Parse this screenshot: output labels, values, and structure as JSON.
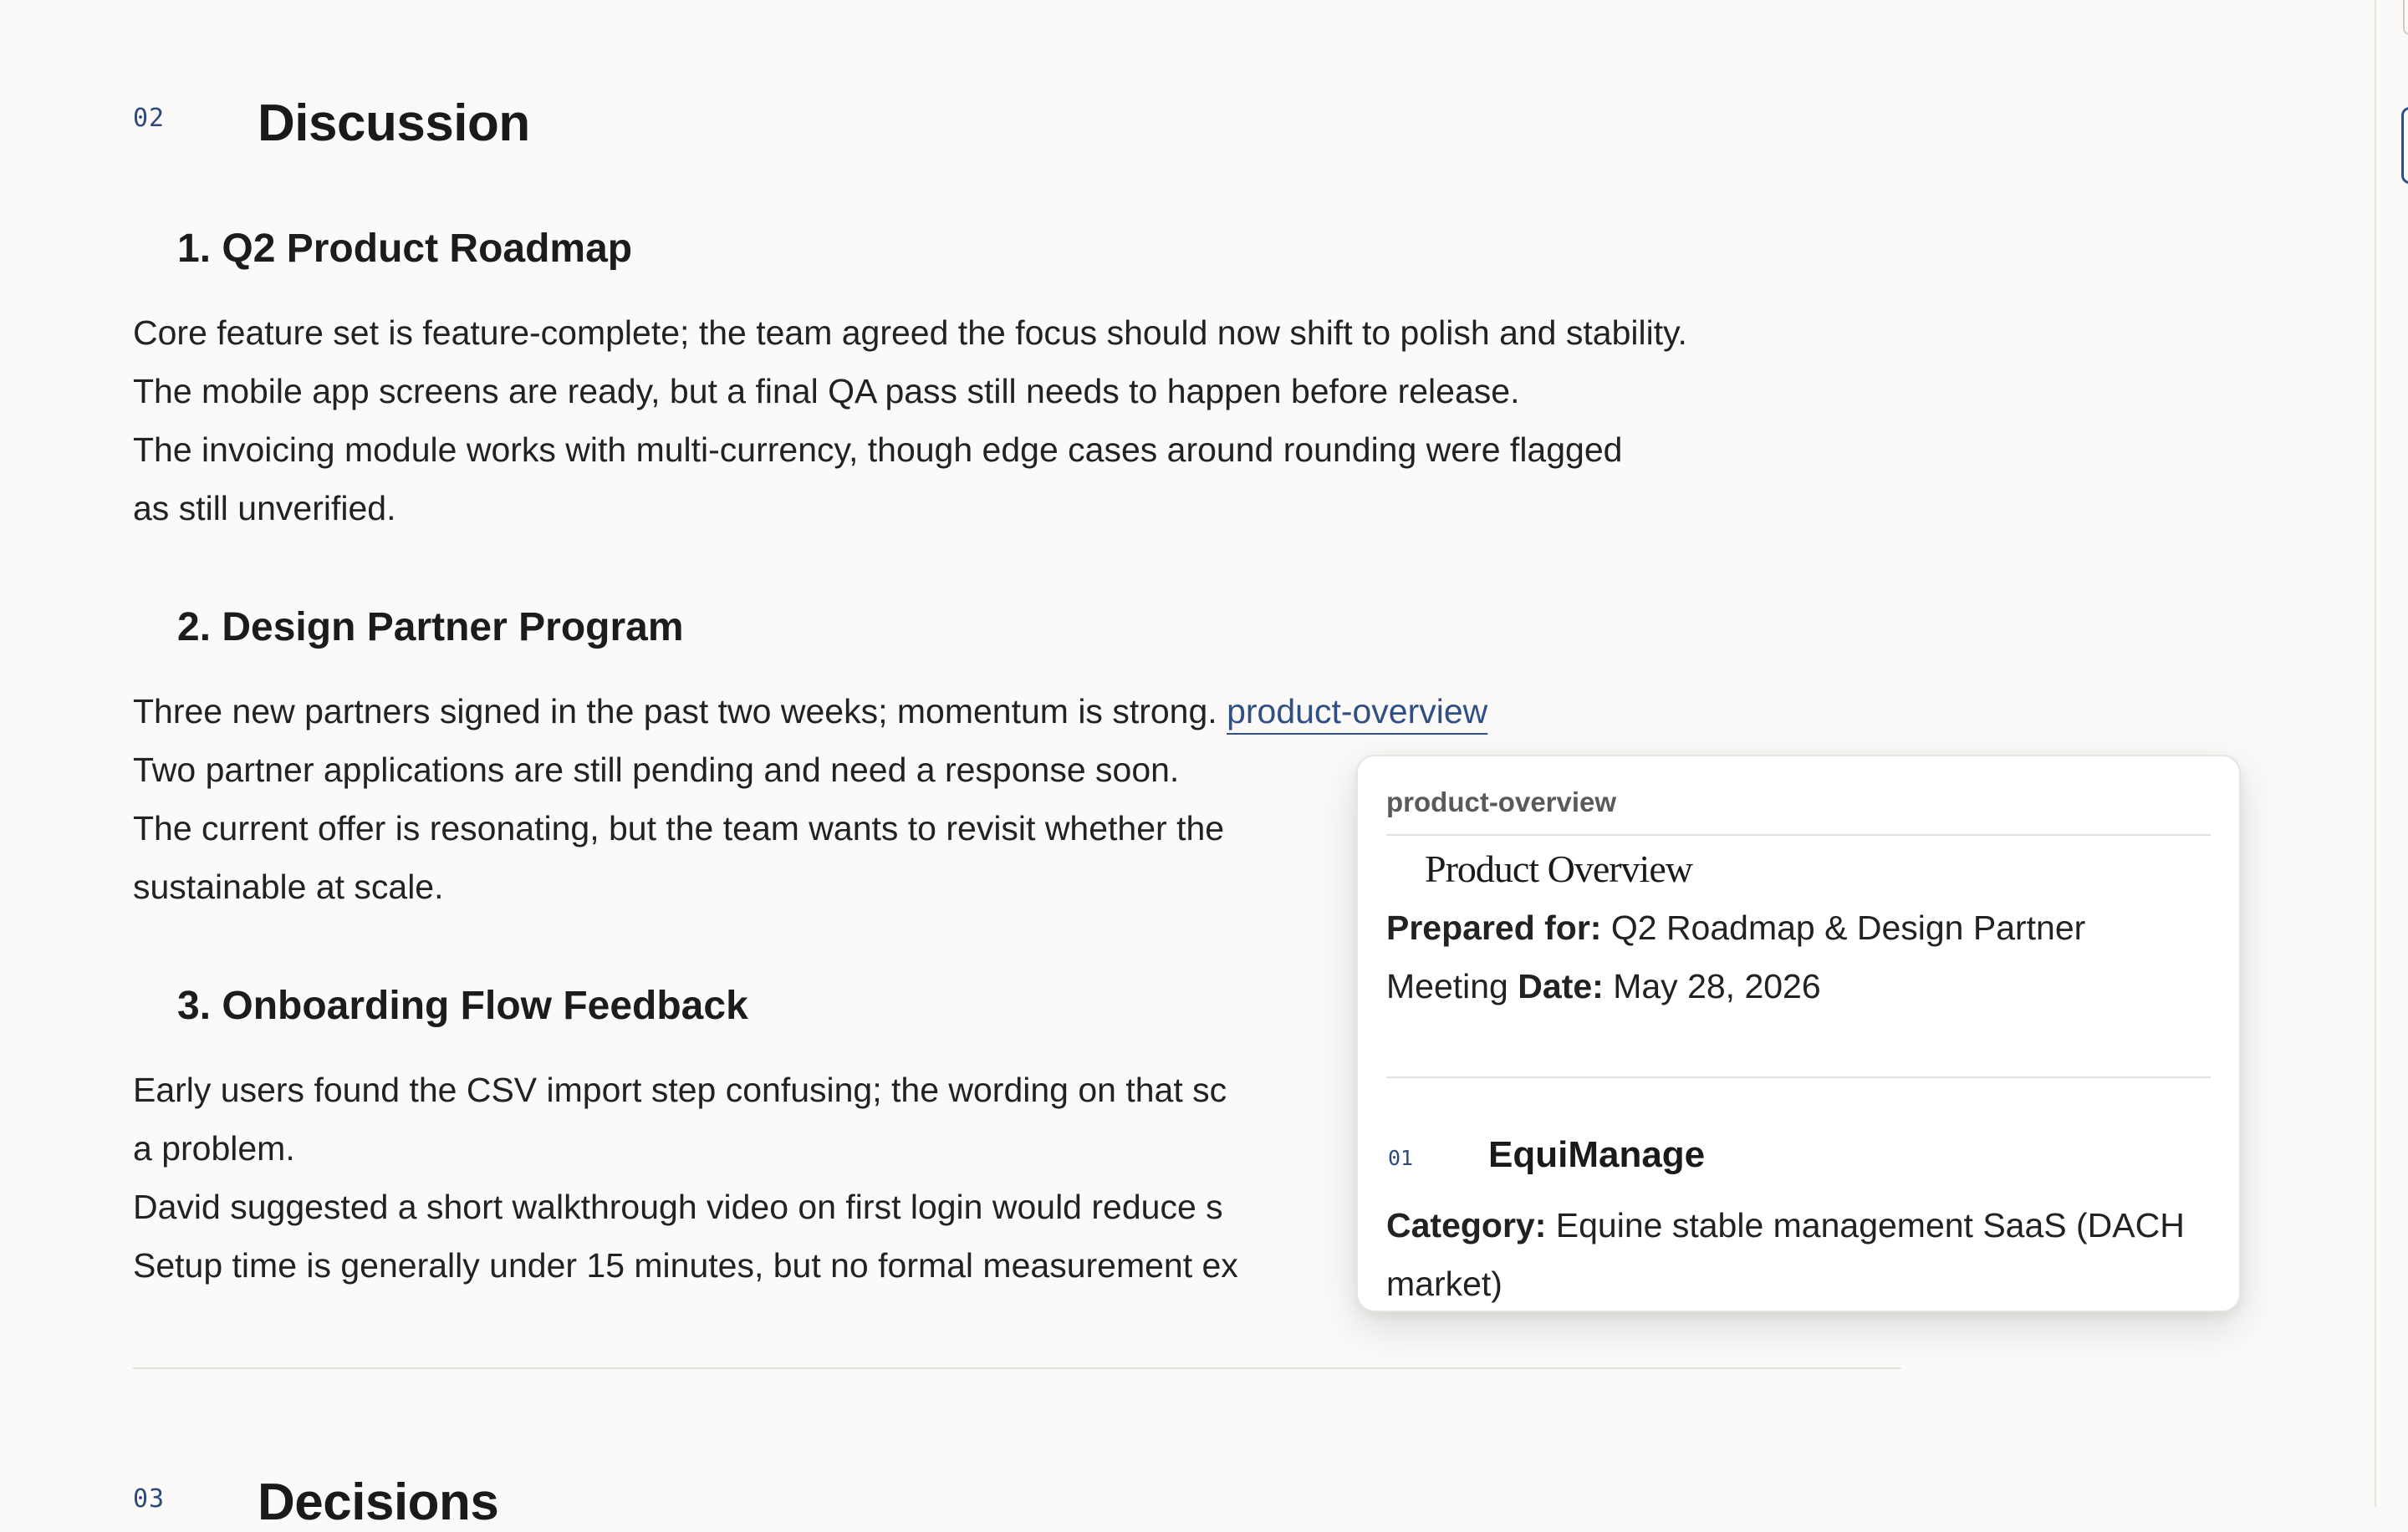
{
  "sections": {
    "discussion": {
      "num": "02",
      "title": "Discussion"
    },
    "decisions": {
      "num": "03",
      "title": "Decisions"
    }
  },
  "topics": [
    {
      "title": "1. Q2 Product Roadmap",
      "lines": [
        "Core feature set is feature-complete; the team agreed the focus should now shift to polish and stability.",
        "The mobile app screens are ready, but a final QA pass still needs to happen before release.",
        "The invoicing module works with multi-currency, though edge cases around rounding were flagged",
        "as still unverified."
      ]
    },
    {
      "title": "2. Design Partner Program",
      "lines": [
        "Three new partners signed in the past two weeks; momentum is strong.",
        "Two partner applications are still pending and need a response soon.",
        "The current offer is resonating, but the team wants to revisit whether the",
        "sustainable at scale."
      ],
      "link": "product-overview"
    },
    {
      "title": "3. Onboarding Flow Feedback",
      "lines": [
        "Early users found the CSV import step confusing; the wording on that sc",
        "a problem.",
        "David suggested a short walkthrough video on first login would reduce s",
        "Setup time is generally under 15 minutes, but no formal measurement ex"
      ]
    }
  ],
  "popover": {
    "label": "product-overview",
    "doc_title": "Product Overview",
    "prepared_for_label": "Prepared for:",
    "prepared_for_value": "Q2 Roadmap & Design Partner Meeting",
    "date_label": "Date:",
    "date_value": "May 28, 2026",
    "section_num": "01",
    "section_title": "EquiManage",
    "category_label": "Category:",
    "category_value": "Equine stable management SaaS (DACH market)"
  }
}
